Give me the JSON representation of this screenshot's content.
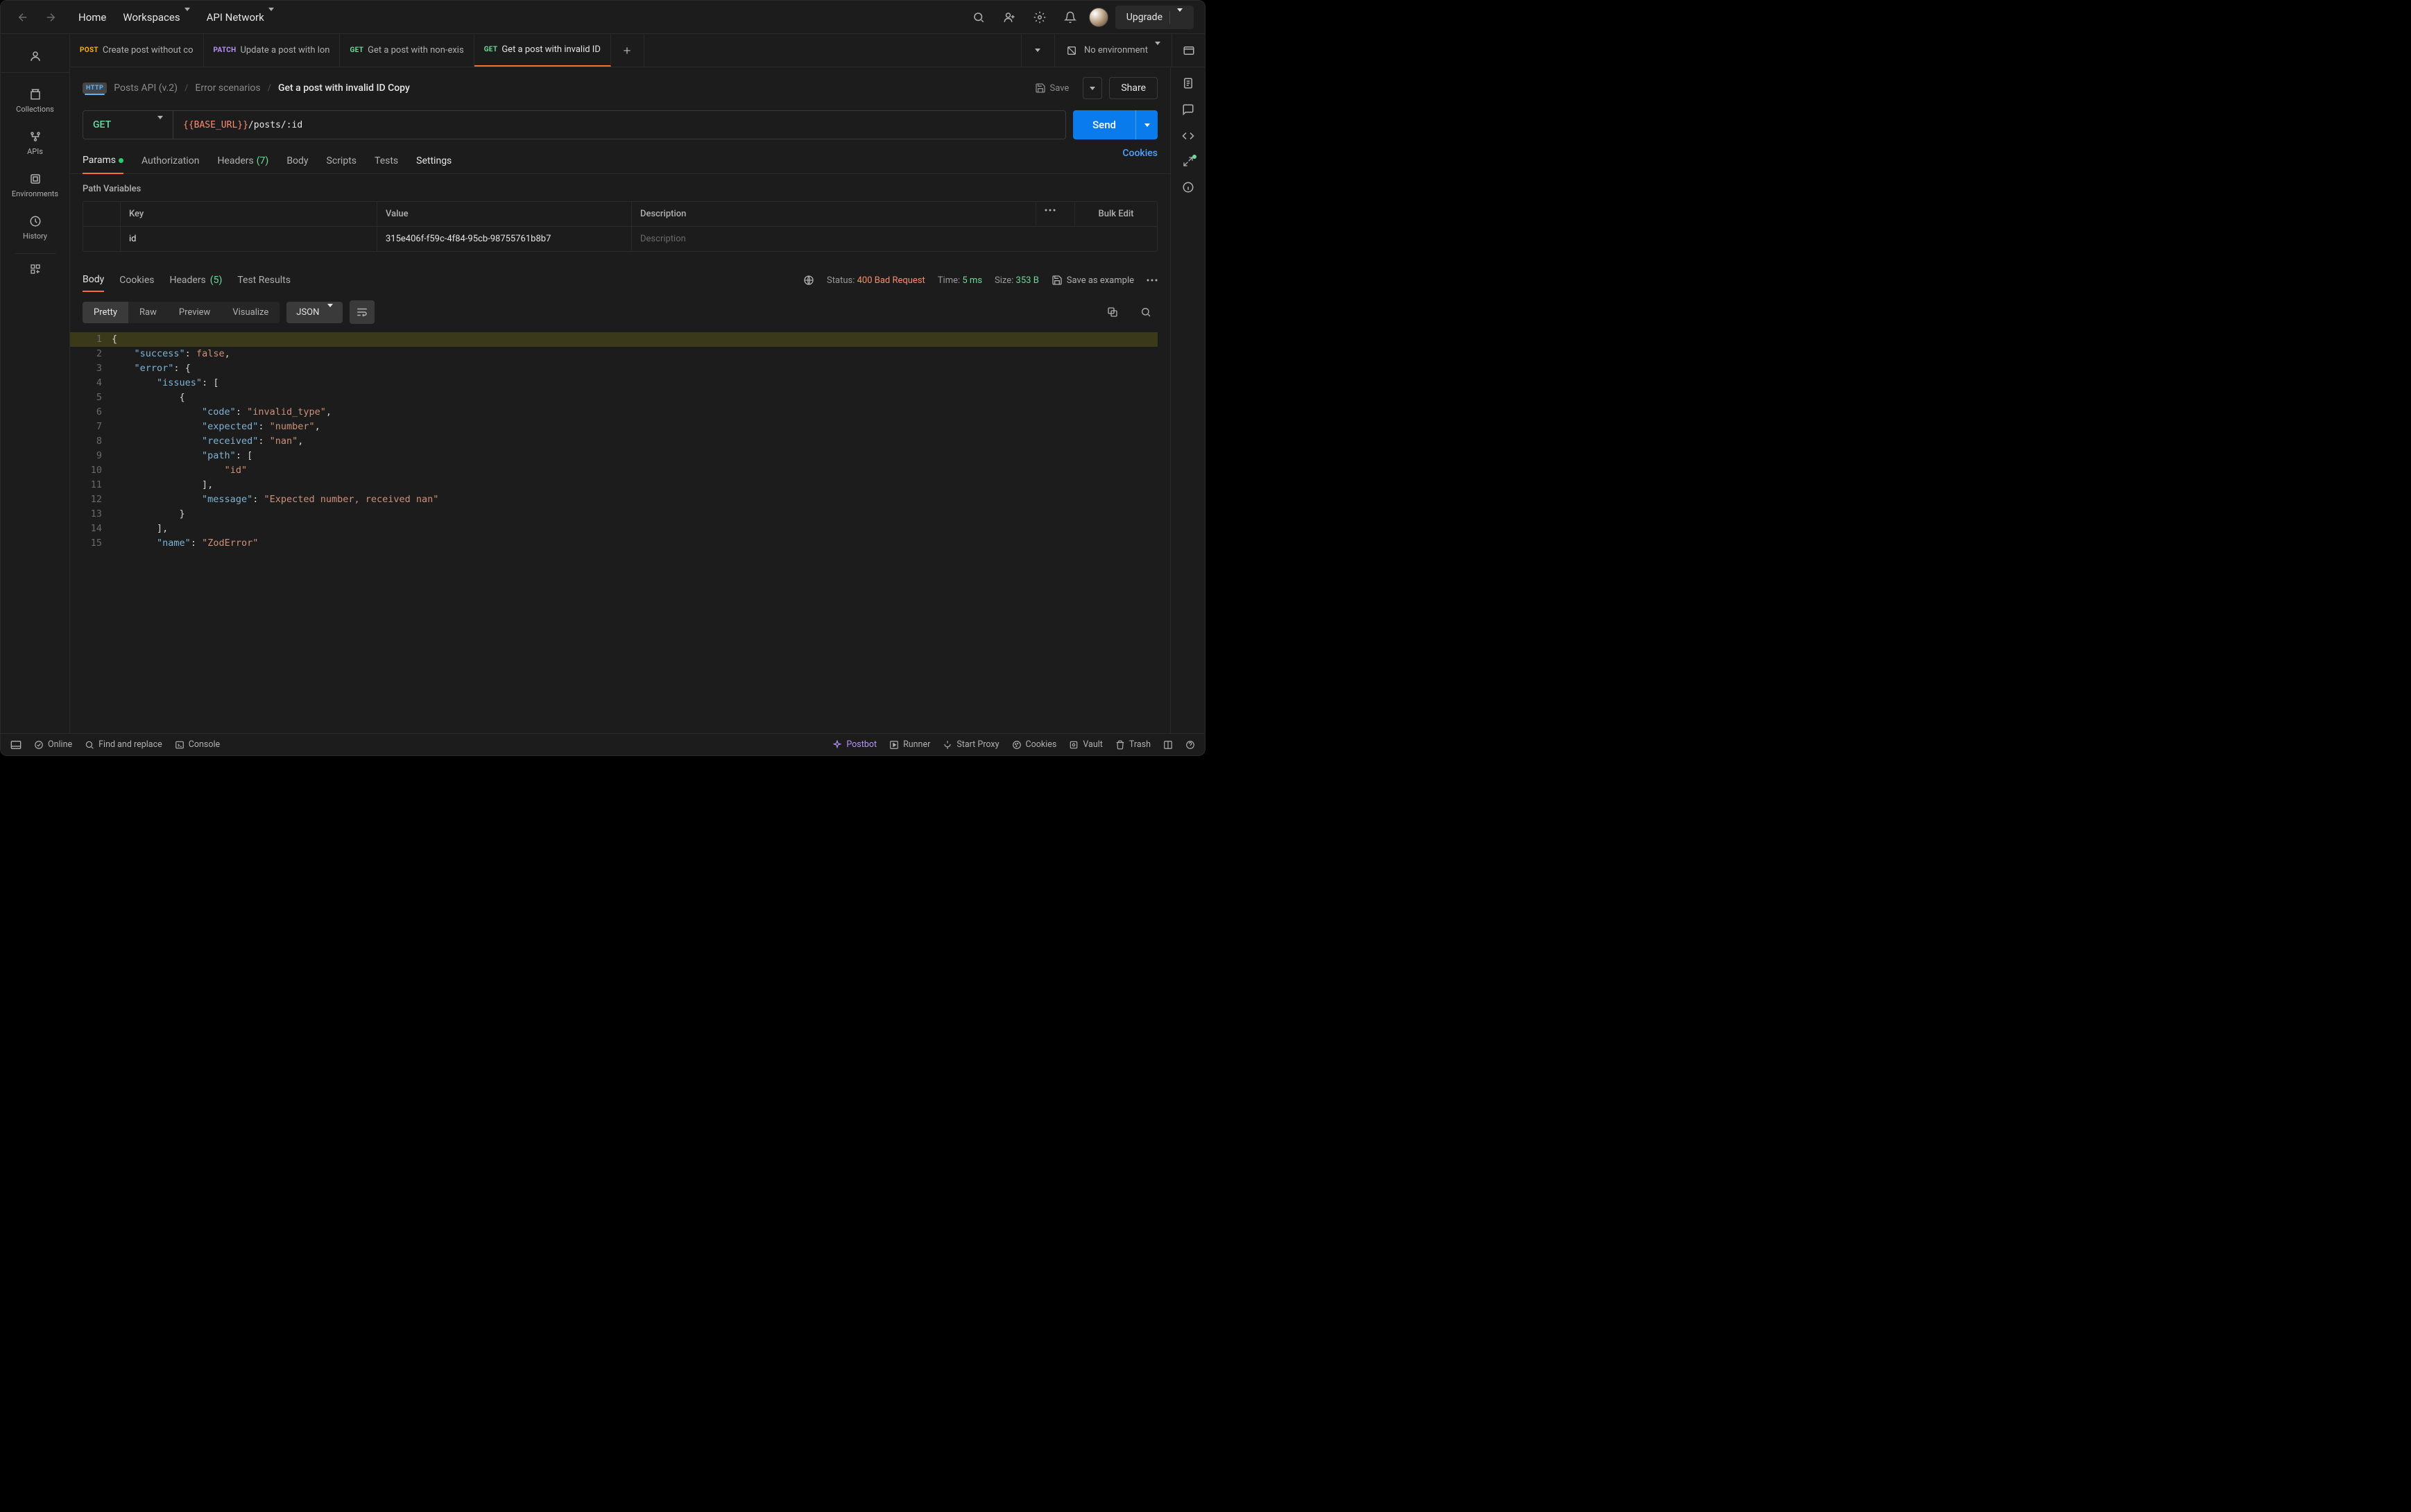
{
  "topbar": {
    "home": "Home",
    "workspaces": "Workspaces",
    "api_network": "API Network",
    "upgrade": "Upgrade"
  },
  "left_nav": {
    "collections": "Collections",
    "apis": "APIs",
    "environments": "Environments",
    "history": "History"
  },
  "tabs": [
    {
      "method": "POST",
      "label": "Create post without co"
    },
    {
      "method": "PATCH",
      "label": "Update a post with lon"
    },
    {
      "method": "GET",
      "label": "Get a post with non-exis"
    },
    {
      "method": "GET",
      "label": "Get a post with invalid ID"
    }
  ],
  "env": {
    "none": "No environment"
  },
  "breadcrumb": {
    "collection": "Posts API (v.2)",
    "folder": "Error scenarios",
    "request": "Get a post with invalid ID Copy",
    "save": "Save",
    "share": "Share"
  },
  "url": {
    "method": "GET",
    "var": "{{BASE_URL}}",
    "path": "/posts/:id",
    "send": "Send"
  },
  "req_tabs": {
    "params": "Params",
    "auth": "Authorization",
    "headers": "Headers",
    "headers_count": "(7)",
    "body": "Body",
    "scripts": "Scripts",
    "tests": "Tests",
    "settings": "Settings",
    "cookies": "Cookies"
  },
  "path_vars": {
    "title": "Path Variables",
    "key_h": "Key",
    "value_h": "Value",
    "desc_h": "Description",
    "bulk": "Bulk Edit",
    "row_key": "id",
    "row_value": "315e406f-f59c-4f84-95cb-98755761b8b7",
    "row_desc_ph": "Description"
  },
  "response": {
    "body": "Body",
    "cookies": "Cookies",
    "headers": "Headers",
    "headers_count": "(5)",
    "test_results": "Test Results",
    "status_l": "Status:",
    "status_v": "400 Bad Request",
    "time_l": "Time:",
    "time_v": "5 ms",
    "size_l": "Size:",
    "size_v": "353 B",
    "save_example": "Save as example",
    "pretty": "Pretty",
    "raw": "Raw",
    "preview": "Preview",
    "visualize": "Visualize",
    "json": "JSON"
  },
  "code": [
    [
      [
        "punc",
        "{"
      ]
    ],
    [
      [
        "punc",
        "    "
      ],
      [
        "key",
        "\"success\""
      ],
      [
        "punc",
        ": "
      ],
      [
        "bool",
        "false"
      ],
      [
        "punc",
        ","
      ]
    ],
    [
      [
        "punc",
        "    "
      ],
      [
        "key",
        "\"error\""
      ],
      [
        "punc",
        ": "
      ],
      [
        "punc",
        "{"
      ]
    ],
    [
      [
        "punc",
        "        "
      ],
      [
        "key",
        "\"issues\""
      ],
      [
        "punc",
        ": "
      ],
      [
        "punc",
        "["
      ]
    ],
    [
      [
        "punc",
        "            "
      ],
      [
        "punc",
        "{"
      ]
    ],
    [
      [
        "punc",
        "                "
      ],
      [
        "key",
        "\"code\""
      ],
      [
        "punc",
        ": "
      ],
      [
        "str",
        "\"invalid_type\""
      ],
      [
        "punc",
        ","
      ]
    ],
    [
      [
        "punc",
        "                "
      ],
      [
        "key",
        "\"expected\""
      ],
      [
        "punc",
        ": "
      ],
      [
        "str",
        "\"number\""
      ],
      [
        "punc",
        ","
      ]
    ],
    [
      [
        "punc",
        "                "
      ],
      [
        "key",
        "\"received\""
      ],
      [
        "punc",
        ": "
      ],
      [
        "str",
        "\"nan\""
      ],
      [
        "punc",
        ","
      ]
    ],
    [
      [
        "punc",
        "                "
      ],
      [
        "key",
        "\"path\""
      ],
      [
        "punc",
        ": "
      ],
      [
        "punc",
        "["
      ]
    ],
    [
      [
        "punc",
        "                    "
      ],
      [
        "str",
        "\"id\""
      ]
    ],
    [
      [
        "punc",
        "                "
      ],
      [
        "punc",
        "],"
      ]
    ],
    [
      [
        "punc",
        "                "
      ],
      [
        "key",
        "\"message\""
      ],
      [
        "punc",
        ": "
      ],
      [
        "str",
        "\"Expected number, received nan\""
      ]
    ],
    [
      [
        "punc",
        "            "
      ],
      [
        "punc",
        "}"
      ]
    ],
    [
      [
        "punc",
        "        "
      ],
      [
        "punc",
        "],"
      ]
    ],
    [
      [
        "punc",
        "        "
      ],
      [
        "key",
        "\"name\""
      ],
      [
        "punc",
        ": "
      ],
      [
        "str",
        "\"ZodError\""
      ]
    ]
  ],
  "footer": {
    "online": "Online",
    "find": "Find and replace",
    "console": "Console",
    "postbot": "Postbot",
    "runner": "Runner",
    "proxy": "Start Proxy",
    "cookies": "Cookies",
    "vault": "Vault",
    "trash": "Trash"
  }
}
